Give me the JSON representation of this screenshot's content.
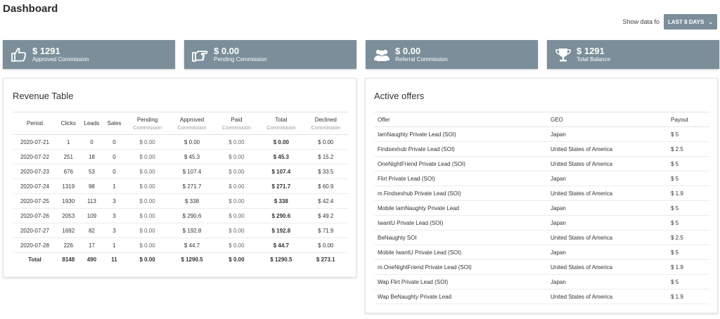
{
  "page": {
    "title": "Dashboard"
  },
  "filter": {
    "label": "Show data fo",
    "button": "LAST 8 DAYS"
  },
  "stats": [
    {
      "icon": "thumbs-up-icon",
      "value": "$ 1291",
      "label": "Approved Commission"
    },
    {
      "icon": "hand-pointing-icon",
      "value": "$ 0.00",
      "label": "Pending Commission"
    },
    {
      "icon": "users-icon",
      "value": "$ 0.00",
      "label": "Referral Commission"
    },
    {
      "icon": "trophy-icon",
      "value": "$ 1291",
      "label": "Total Balance"
    }
  ],
  "revenue": {
    "title": "Revenue Table",
    "headers": [
      {
        "main": "Period",
        "sub": ""
      },
      {
        "main": "Clicks",
        "sub": ""
      },
      {
        "main": "Leads",
        "sub": ""
      },
      {
        "main": "Sales",
        "sub": ""
      },
      {
        "main": "Pending",
        "sub": "Commission"
      },
      {
        "main": "Approved",
        "sub": "Commission"
      },
      {
        "main": "Paid",
        "sub": "Commission"
      },
      {
        "main": "Total",
        "sub": "Commission"
      },
      {
        "main": "Declined",
        "sub": "Commission"
      }
    ],
    "rows": [
      [
        "2020-07-21",
        "1",
        "0",
        "0",
        "$ 0.00",
        "$ 0.00",
        "$ 0.00",
        "$ 0.00",
        "$ 0.00"
      ],
      [
        "2020-07-22",
        "251",
        "18",
        "0",
        "$ 0.00",
        "$ 45.3",
        "$ 0.00",
        "$ 45.3",
        "$ 15.2"
      ],
      [
        "2020-07-23",
        "676",
        "53",
        "0",
        "$ 0.00",
        "$ 107.4",
        "$ 0.00",
        "$ 107.4",
        "$ 33.5"
      ],
      [
        "2020-07-24",
        "1319",
        "98",
        "1",
        "$ 0.00",
        "$ 271.7",
        "$ 0.00",
        "$ 271.7",
        "$ 60.9"
      ],
      [
        "2020-07-25",
        "1930",
        "113",
        "3",
        "$ 0.00",
        "$ 338",
        "$ 0.00",
        "$ 338",
        "$ 42.4"
      ],
      [
        "2020-07-26",
        "2053",
        "109",
        "3",
        "$ 0.00",
        "$ 290.6",
        "$ 0.00",
        "$ 290.6",
        "$ 49.2"
      ],
      [
        "2020-07-27",
        "1692",
        "82",
        "3",
        "$ 0.00",
        "$ 192.8",
        "$ 0.00",
        "$ 192.8",
        "$ 71.9"
      ],
      [
        "2020-07-28",
        "226",
        "17",
        "1",
        "$ 0.00",
        "$ 44.7",
        "$ 0.00",
        "$ 44.7",
        "$ 0.00"
      ]
    ],
    "total": [
      "Total",
      "8148",
      "490",
      "11",
      "$ 0.00",
      "$ 1290.5",
      "$ 0.00",
      "$ 1290.5",
      "$ 273.1"
    ]
  },
  "offers": {
    "title": "Active offers",
    "headers": [
      "Offer",
      "GEO",
      "Payout"
    ],
    "rows": [
      [
        "IamNaughty Private Lead (SOI)",
        "Japan",
        "$ 5"
      ],
      [
        "Findsexhub Private Lead (SOI)",
        "United States of America",
        "$ 2.5"
      ],
      [
        "OneNightFriend Private Lead (SOI)",
        "United States of America",
        "$ 5"
      ],
      [
        "Flirt Private Lead (SOI)",
        "Japan",
        "$ 5"
      ],
      [
        "m.Findsexhub Private Lead (SOI)",
        "United States of America",
        "$ 1.9"
      ],
      [
        "Mobile IamNaughty Private Lead",
        "Japan",
        "$ 5"
      ],
      [
        "IwantU Private Lead (SOI)",
        "Japan",
        "$ 5"
      ],
      [
        "BeNaughty SOI",
        "United States of America",
        "$ 2.5"
      ],
      [
        "Mobile IwantU Private Lead (SOI)",
        "Japan",
        "$ 5"
      ],
      [
        "m.OneNightFriend Private Lead (SOI)",
        "United States of America",
        "$ 1.9"
      ],
      [
        "Wap Flirt Private Lead (SOI)",
        "Japan",
        "$ 5"
      ],
      [
        "Wap BeNaughty Private Lead",
        "United States of America",
        "$ 1.9"
      ]
    ]
  }
}
